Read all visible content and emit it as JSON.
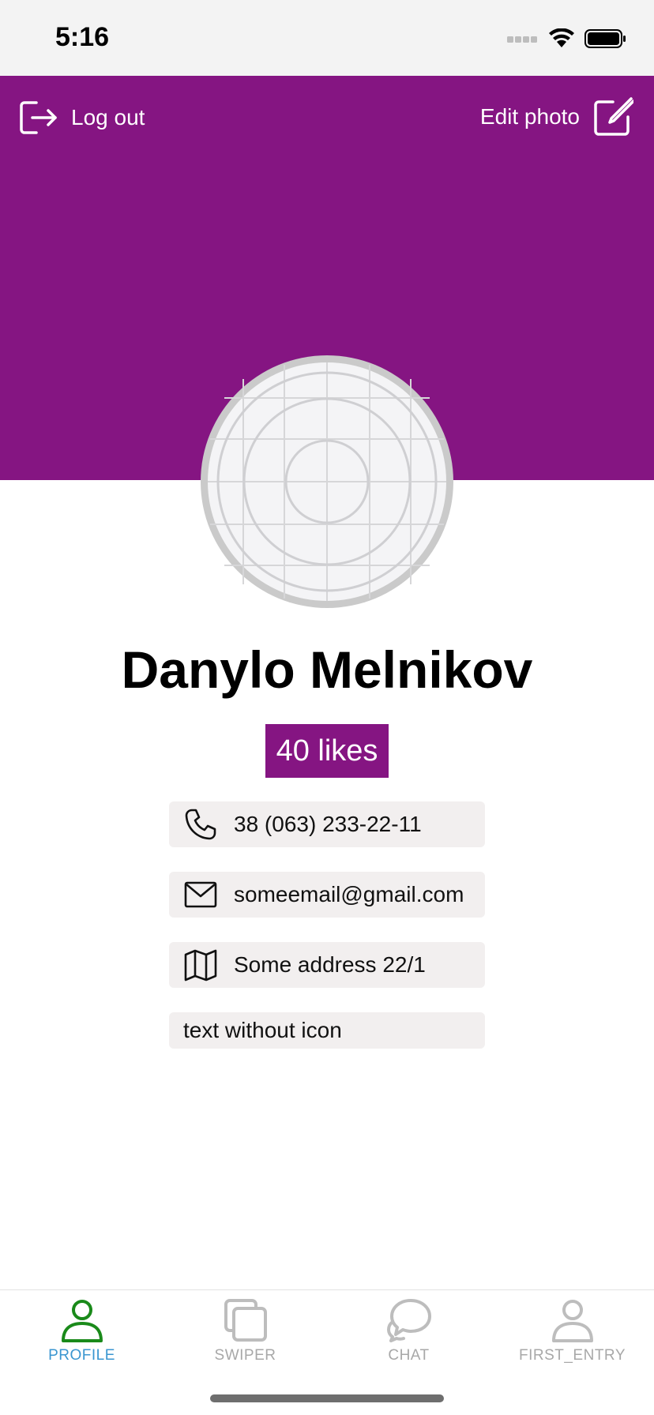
{
  "status_bar": {
    "time": "5:16"
  },
  "header": {
    "logout_label": "Log out",
    "edit_photo_label": "Edit photo",
    "background_color": "#851582"
  },
  "profile": {
    "name": "Danylo Melnikov",
    "likes": "40 likes"
  },
  "info": {
    "phone": "38 (063) 233-22-11",
    "email": "someemail@gmail.com",
    "address": "Some address 22/1",
    "plain": "text without icon"
  },
  "icons": {
    "phone": "phone-icon",
    "email": "mail-icon",
    "address": "map-icon",
    "logout": "logout-icon",
    "edit": "edit-icon"
  },
  "tabs": [
    {
      "label": "PROFILE",
      "icon": "person-icon",
      "active": true
    },
    {
      "label": "SWIPER",
      "icon": "cards-icon",
      "active": false
    },
    {
      "label": "CHAT",
      "icon": "chat-icon",
      "active": false
    },
    {
      "label": "FIRST_ENTRY",
      "icon": "person-icon",
      "active": false
    }
  ],
  "colors": {
    "accent": "#851582",
    "tab_active_icon": "#1a8a1a",
    "tab_active_label": "#3a96d0",
    "tab_inactive": "#a8a8a8",
    "info_background": "#f2efef"
  }
}
